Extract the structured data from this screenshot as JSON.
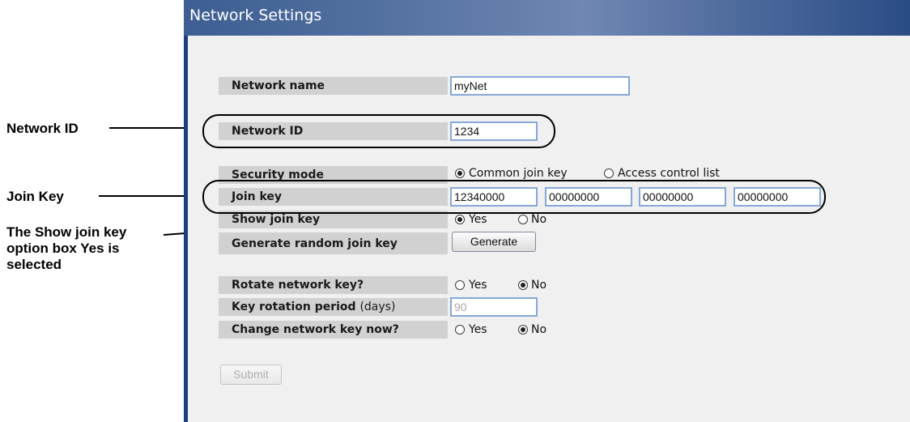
{
  "annotations": {
    "network_id": "Network ID",
    "join_key": "Join Key",
    "show_join_key_lines": [
      "The Show join key",
      "option box Yes is",
      "selected"
    ]
  },
  "panel": {
    "title": "Network Settings"
  },
  "form": {
    "network_name": {
      "label": "Network name",
      "value": "myNet"
    },
    "network_id": {
      "label": "Network ID",
      "value": "1234"
    },
    "security_mode": {
      "label": "Security mode",
      "options": [
        "Common join key",
        "Access control list"
      ],
      "selected": "Common join key"
    },
    "join_key": {
      "label": "Join key",
      "values": [
        "12340000",
        "00000000",
        "00000000",
        "00000000"
      ]
    },
    "show_join_key": {
      "label": "Show join key",
      "options": [
        "Yes",
        "No"
      ],
      "selected": "Yes"
    },
    "generate_random_join_key": {
      "label": "Generate random join key",
      "button": "Generate"
    },
    "rotate_network_key": {
      "label": "Rotate network key?",
      "options": [
        "Yes",
        "No"
      ],
      "selected": "No"
    },
    "key_rotation_period": {
      "label": "Key rotation period",
      "unit": "(days)",
      "value": "90"
    },
    "change_network_key_now": {
      "label": "Change network key now?",
      "options": [
        "Yes",
        "No"
      ],
      "selected": "No"
    },
    "submit_label": "Submit"
  }
}
